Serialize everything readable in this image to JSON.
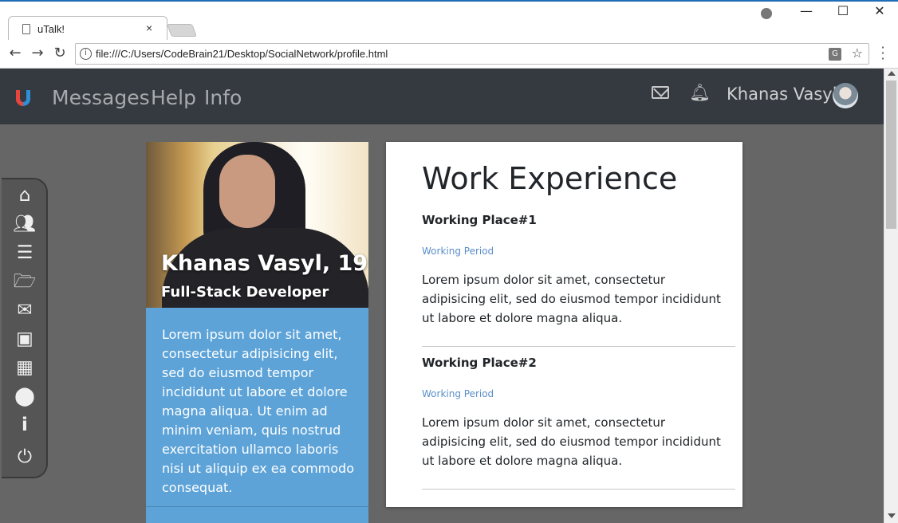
{
  "browser": {
    "tab_title": "uTalk!",
    "tab_close": "×",
    "url": "file:///C:/Users/CodeBrain21/Desktop/SocialNetwork/profile.html",
    "window_controls": {
      "minimize": "—",
      "maximize": "☐",
      "close": "✕"
    },
    "nav": {
      "back": "←",
      "forward": "→",
      "reload": "↻"
    }
  },
  "navbar": {
    "links": [
      "Messages",
      "Help",
      "Info"
    ],
    "user_name": "Khanas Vasyl",
    "icons": [
      "mail-icon",
      "bell-icon"
    ]
  },
  "sidebar": {
    "items": [
      "home-icon",
      "users-icon",
      "list-icon",
      "folder-open-icon",
      "envelope-icon",
      "camera-icon",
      "table-icon",
      "map-marker-icon",
      "info-icon",
      "power-icon"
    ]
  },
  "profile": {
    "name_age": "Khanas Vasyl, 19",
    "role": "Full-Stack Developer",
    "bio": "Lorem ipsum dolor sit amet, consectetur adipisicing elit, sed do eiusmod tempor incididunt ut labore et dolore magna aliqua. Ut enim ad minim veniam, quis nostrud exercitation ullamco laboris nisi ut aliquip ex ea commodo consequat."
  },
  "work": {
    "title": "Work Experience",
    "jobs": [
      {
        "place": "Working Place#1",
        "period": "Working Period",
        "description": "Lorem ipsum dolor sit amet, consectetur adipisicing elit, sed do eiusmod tempor incididunt ut labore et dolore magna aliqua."
      },
      {
        "place": "Working Place#2",
        "period": "Working Period",
        "description": "Lorem ipsum dolor sit amet, consectetur adipisicing elit, sed do eiusmod tempor incididunt ut labore et dolore magna aliqua."
      }
    ]
  },
  "colors": {
    "navbar": "#343a40",
    "page_bg": "#666666",
    "profile_card": "#5da3d8",
    "period_text": "#5b8fc9"
  }
}
